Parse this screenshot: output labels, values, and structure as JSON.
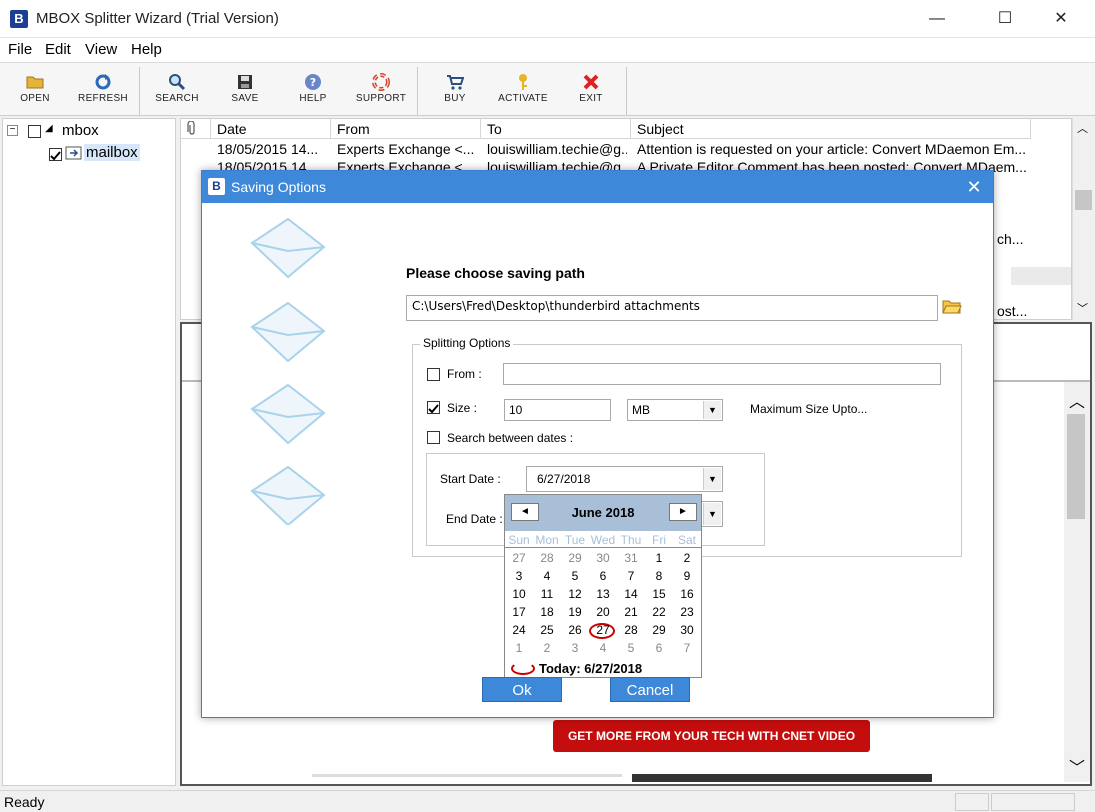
{
  "window": {
    "title": "MBOX Splitter Wizard (Trial Version)",
    "logo_letter": "B",
    "minimize": "—",
    "maximize": "☐",
    "close": "✕"
  },
  "menu": [
    "File",
    "Edit",
    "View",
    "Help"
  ],
  "toolbar": {
    "open": "OPEN",
    "refresh": "REFRESH",
    "search": "SEARCH",
    "save": "SAVE",
    "help": "HELP",
    "support": "SUPPORT",
    "buy": "BUY",
    "activate": "ACTIVATE",
    "exit": "EXIT"
  },
  "tree": {
    "root": "mbox",
    "child": "mailbox"
  },
  "list": {
    "columns": {
      "date": "Date",
      "from": "From",
      "to": "To",
      "subject": "Subject"
    },
    "rows": [
      {
        "date": "18/05/2015 14...",
        "from": "Experts Exchange <...",
        "to": "louiswilliam.techie@g...",
        "subject": "Attention is requested on your article: Convert MDaemon Em..."
      },
      {
        "date": "18/05/2015 14...",
        "from": "Experts Exchange <...",
        "to": "louiswilliam.techie@g...",
        "subject": "A Private Editor Comment has been posted: Convert MDaem..."
      }
    ],
    "trunc_1": "ch...",
    "trunc_2": "ost..."
  },
  "preview": {
    "cnet_button": "GET MORE FROM YOUR TECH WITH CNET VIDEO"
  },
  "status": {
    "text": "Ready"
  },
  "dialog": {
    "title": "Saving Options",
    "logo_letter": "B",
    "close": "✕",
    "choose_label": "Please choose saving path",
    "path": "C:\\Users\\Fred\\Desktop\\thunderbird attachments",
    "splitting_legend": "Splitting Options",
    "from_label": "From :",
    "from_value": "",
    "size_label": "Size :",
    "size_value": "10",
    "size_unit": "MB",
    "max_size_label": "Maximum Size Upto...",
    "search_dates_label": "Search between dates :",
    "start_date_label": "Start Date :",
    "start_date_value": "6/27/2018",
    "end_date_label": "End Date :",
    "ok": "Ok",
    "cancel": "Cancel",
    "checks": {
      "from": false,
      "size": true,
      "search_dates": false
    }
  },
  "calendar": {
    "month_label": "June 2018",
    "prev": "◄",
    "next": "►",
    "weekdays": [
      "Sun",
      "Mon",
      "Tue",
      "Wed",
      "Thu",
      "Fri",
      "Sat"
    ],
    "weeks": [
      [
        "27",
        "28",
        "29",
        "30",
        "31",
        "1",
        "2"
      ],
      [
        "3",
        "4",
        "5",
        "6",
        "7",
        "8",
        "9"
      ],
      [
        "10",
        "11",
        "12",
        "13",
        "14",
        "15",
        "16"
      ],
      [
        "17",
        "18",
        "19",
        "20",
        "21",
        "22",
        "23"
      ],
      [
        "24",
        "25",
        "26",
        "27",
        "28",
        "29",
        "30"
      ],
      [
        "1",
        "2",
        "3",
        "4",
        "5",
        "6",
        "7"
      ]
    ],
    "today_label": "Today: 6/27/2018",
    "selected_day": "27"
  },
  "colors": {
    "dialog_title": "#3d88d8",
    "calendar_header": "#a9bfd8",
    "cnet_red": "#c40d0d",
    "today_circle": "#cc0000"
  }
}
